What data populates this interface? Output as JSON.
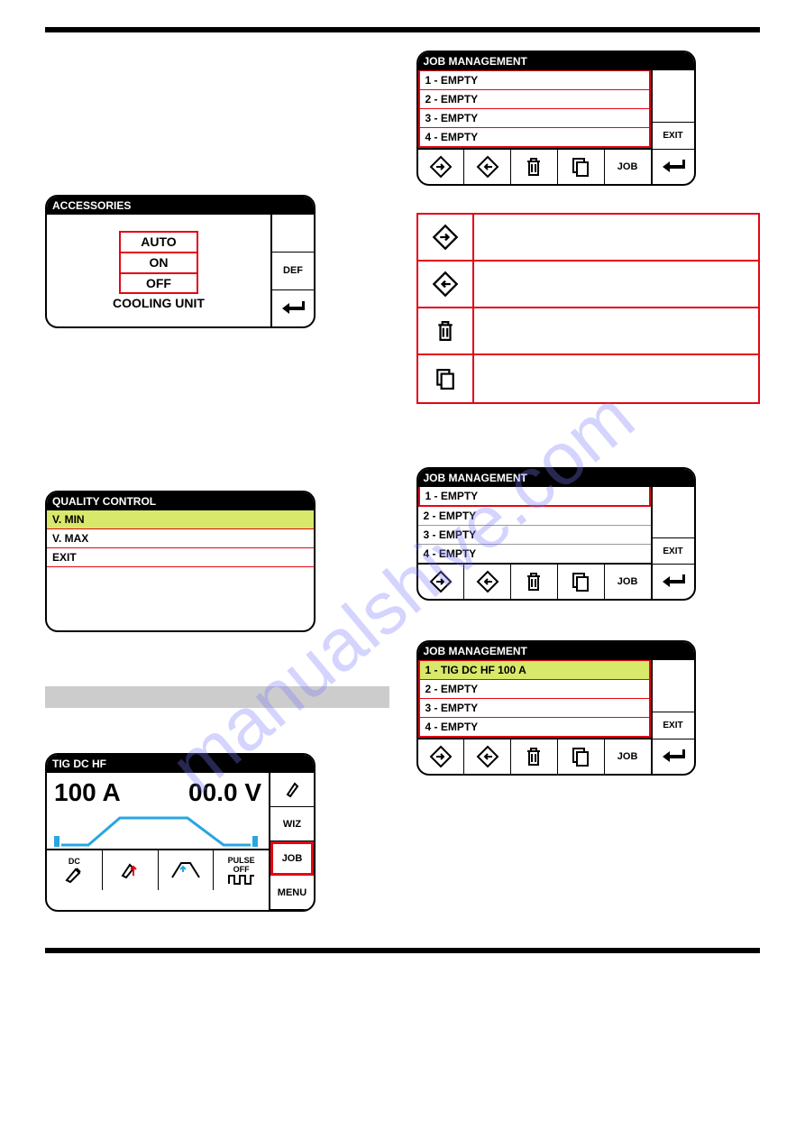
{
  "watermark": "manualshive.com",
  "accessories": {
    "title": "ACCESSORIES",
    "options": {
      "opt1": "AUTO",
      "opt2": "ON",
      "opt3": "OFF"
    },
    "label": "COOLING UNIT",
    "side": {
      "def": "DEF"
    }
  },
  "quality": {
    "title": "QUALITY CONTROL",
    "rows": {
      "r1": "V. MIN",
      "r2": "V. MAX",
      "r3": "EXIT"
    }
  },
  "tig": {
    "title": "TIG DC HF",
    "amps": "100 A",
    "volts": "00.0 V",
    "side": {
      "wiz": "WIZ",
      "job": "JOB",
      "menu": "MENU"
    },
    "bottom": {
      "dc": "DC",
      "pulse1": "PULSE",
      "pulse2": "OFF"
    }
  },
  "job1": {
    "title": "JOB MANAGEMENT",
    "rows": {
      "r1": "1 - EMPTY",
      "r2": "2 - EMPTY",
      "r3": "3 - EMPTY",
      "r4": "4 - EMPTY"
    },
    "side": {
      "exit": "EXIT",
      "job": "JOB"
    }
  },
  "job2": {
    "title": "JOB MANAGEMENT",
    "rows": {
      "r1": "1 - EMPTY",
      "r2": "2 - EMPTY",
      "r3": "3 - EMPTY",
      "r4": "4 - EMPTY"
    },
    "side": {
      "exit": "EXIT",
      "job": "JOB"
    }
  },
  "job3": {
    "title": "JOB MANAGEMENT",
    "rows": {
      "r1": "1 - TIG DC HF 100 A",
      "r2": "2 - EMPTY",
      "r3": "3 - EMPTY",
      "r4": "4 - EMPTY"
    },
    "side": {
      "exit": "EXIT",
      "job": "JOB"
    }
  }
}
